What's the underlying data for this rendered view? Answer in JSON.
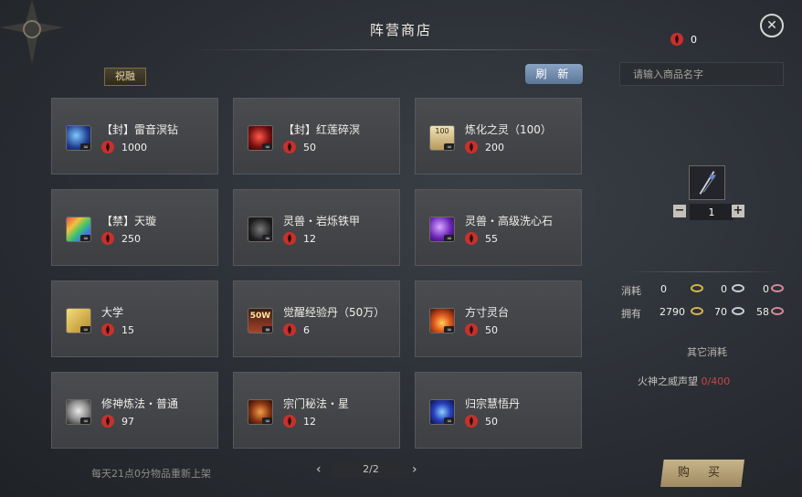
{
  "header": {
    "title": "阵营商店",
    "currency_amount": "0"
  },
  "toolbar": {
    "tag_label": "祝融",
    "refresh_label": "刷 新"
  },
  "search": {
    "placeholder": "请输入商品名字"
  },
  "items": [
    {
      "name": "【封】雷音溟钻",
      "price": "1000",
      "icon": "blue-gem-icon"
    },
    {
      "name": "【封】红莲碎溟",
      "price": "50",
      "icon": "red-gem-icon"
    },
    {
      "name": "炼化之灵（100）",
      "price": "200",
      "icon": "scroll-icon",
      "icon_text": "100"
    },
    {
      "name": "【禁】天璇",
      "price": "250",
      "icon": "rainbow-shard-icon"
    },
    {
      "name": "灵兽・岩烁铁甲",
      "price": "12",
      "icon": "chain-armor-icon"
    },
    {
      "name": "灵兽・高级洗心石",
      "price": "55",
      "icon": "purple-stone-icon"
    },
    {
      "name": "大学",
      "price": "15",
      "icon": "book-icon"
    },
    {
      "name": "觉醒经验丹（50万）",
      "price": "6",
      "icon": "exp-pill-icon",
      "icon_text": "50W"
    },
    {
      "name": "方寸灵台",
      "price": "50",
      "icon": "flame-shrine-icon"
    },
    {
      "name": "修神炼法・普通",
      "price": "97",
      "icon": "mask-icon"
    },
    {
      "name": "宗门秘法・星",
      "price": "12",
      "icon": "star-secret-icon"
    },
    {
      "name": "归宗慧悟丹",
      "price": "50",
      "icon": "blue-orb-icon"
    }
  ],
  "detail": {
    "preview_icon": "weapon-icon",
    "quantity": "1",
    "cost_label": "消耗",
    "own_label": "拥有",
    "cost_values": [
      "0",
      "0",
      "0"
    ],
    "own_values": [
      "2790",
      "70",
      "58"
    ],
    "other_cost_label": "其它消耗",
    "prestige_label": "火神之威声望",
    "prestige_value": "0/400"
  },
  "footer": {
    "daily_note": "每天21点0分物品重新上架",
    "page": "2/2",
    "buy_label": "购 买"
  },
  "colors": {
    "gold_ring": "#d9b54a",
    "silver_ring": "#c9cfd8",
    "pink_ring": "#d88a9a",
    "prestige_red": "#c84545",
    "flame_red": "#c8302c"
  }
}
